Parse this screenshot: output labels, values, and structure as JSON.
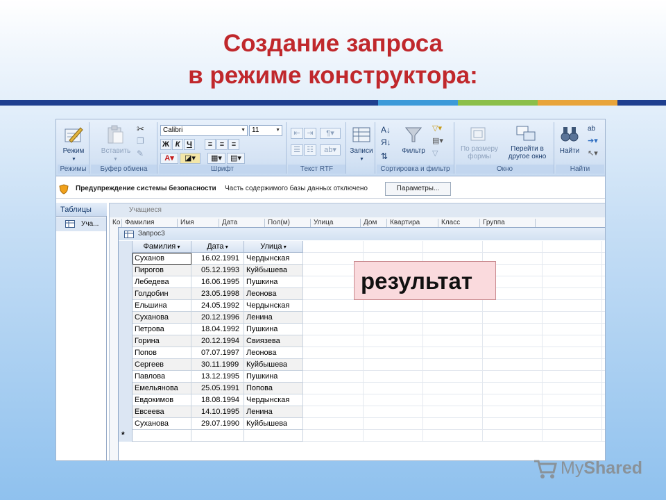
{
  "slide": {
    "title_line1": "Создание запроса",
    "title_line2": "в режиме конструктора:",
    "colors": {
      "title": "#c0282c",
      "bar_navy": "#1f3f8f",
      "bar_blue": "#3c9ad9",
      "bar_green": "#8bbf4a",
      "bar_orange": "#e8a43a"
    }
  },
  "ribbon": {
    "mode_label": "Режим",
    "modes_group": "Режимы",
    "paste_label": "Вставить",
    "clipboard_group": "Буфер обмена",
    "font_name": "Calibri",
    "font_size": "11",
    "bold": "Ж",
    "italic": "К",
    "underline": "Ч",
    "font_group": "Шрифт",
    "rtf_group": "Текст RTF",
    "records_label": "Записи",
    "filter_label": "Фильтр",
    "sort_filter_group": "Сортировка и фильтр",
    "fit_form_label": "По размеру формы",
    "switch_window_label": "Перейти в другое окно",
    "window_group": "Окно",
    "find_label": "Найти",
    "find_group": "Найти"
  },
  "security": {
    "title": "Предупреждение системы безопасности",
    "message": "Часть содержимого базы данных отключено",
    "button": "Параметры..."
  },
  "nav": {
    "header": "Таблицы",
    "item": "Уча..."
  },
  "background_table": {
    "title": "Учащиеся",
    "headers": [
      "Ко",
      "Фамилия",
      "Имя",
      "Дата",
      "Пол(м)",
      "Улица",
      "Дом",
      "Квартира",
      "Класс",
      "Группа"
    ]
  },
  "query": {
    "title": "Запрос3",
    "headers": [
      "Фамилия",
      "Дата",
      "Улица"
    ],
    "rows": [
      [
        "Суханов",
        "16.02.1991",
        "Чердынская"
      ],
      [
        "Пирогов",
        "05.12.1993",
        "Куйбышева"
      ],
      [
        "Лебедева",
        "16.06.1995",
        "Пушкина"
      ],
      [
        "Голдобин",
        "23.05.1998",
        "Леонова"
      ],
      [
        "Ельшина",
        "24.05.1992",
        "Чердынская"
      ],
      [
        "Суханова",
        "20.12.1996",
        "Ленина"
      ],
      [
        "Петрова",
        "18.04.1992",
        "Пушкина"
      ],
      [
        "Горина",
        "20.12.1994",
        "Свиязева"
      ],
      [
        "Попов",
        "07.07.1997",
        "Леонова"
      ],
      [
        "Сергеев",
        "30.11.1999",
        "Куйбышева"
      ],
      [
        "Павлова",
        "13.12.1995",
        "Пушкина"
      ],
      [
        "Емельянова",
        "25.05.1991",
        "Попова"
      ],
      [
        "Евдокимов",
        "18.08.1994",
        "Чердынская"
      ],
      [
        "Евсеева",
        "14.10.1995",
        "Ленина"
      ],
      [
        "Суханова",
        "29.07.1990",
        "Куйбышева"
      ]
    ],
    "new_row_marker": "*"
  },
  "callout": {
    "text": "результат"
  },
  "watermark": {
    "text": "MyShared"
  }
}
